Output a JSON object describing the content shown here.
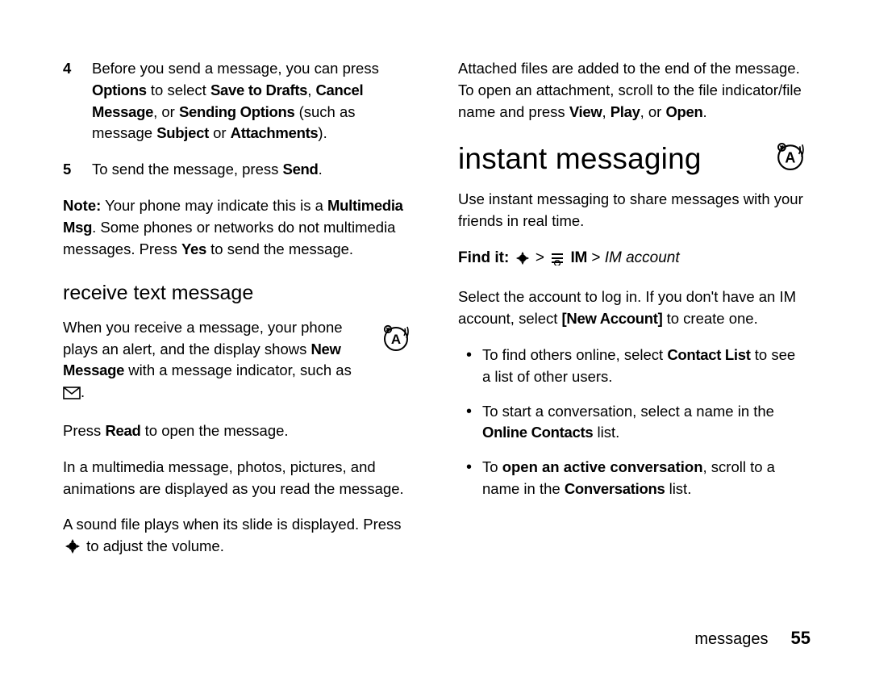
{
  "chart_data": null,
  "left": {
    "step4": {
      "num": "4",
      "t1": "Before you send a message, you can press ",
      "k1": "Options",
      "t2": " to select ",
      "k2": "Save to Drafts",
      "t3": ", ",
      "k3": "Cancel Message",
      "t4": ", or ",
      "k4": "Sending Options",
      "t5": " (such as message ",
      "k5": "Subject",
      "t6": " or ",
      "k6": "Attachments",
      "t7": ")."
    },
    "step5": {
      "num": "5",
      "t1": "To send the message, press ",
      "k1": "Send",
      "t2": "."
    },
    "note": {
      "label": "Note:",
      "t1": " Your phone may indicate this is a ",
      "k1": "Multimedia Msg",
      "t2": ". Some phones or networks do not multimedia messages. Press ",
      "k2": "Yes",
      "t3": " to send the message."
    },
    "h2": "receive text message",
    "rcv": {
      "t1": "When you receive a message, your phone plays an alert, and the display shows ",
      "k1": "New Message",
      "t2": " with a message indicator, such as ",
      "t3": "."
    },
    "read": {
      "t1": "Press ",
      "k1": "Read",
      "t2": " to open the message."
    },
    "mm": "In a multimedia message, photos, pictures, and animations are displayed as you read the message.",
    "sound": {
      "t1": "A sound file plays when its slide is displayed. Press ",
      "t2": " to adjust the volume."
    }
  },
  "right": {
    "attach": {
      "t1": "Attached files are added to the end of the message. To open an attachment, scroll to the file indicator/file name and press ",
      "k1": "View",
      "t2": ", ",
      "k2": "Play",
      "t3": ", or ",
      "k3": "Open",
      "t4": "."
    },
    "h1": "instant messaging",
    "im_intro": "Use instant messaging to share messages with your friends in real time.",
    "findit": {
      "label": "Find it:",
      "sep1": " > ",
      "k1": "IM",
      "sep2": " > ",
      "ital": "IM account"
    },
    "login": {
      "t1": "Select the account to log in. If you don't have an IM account, select ",
      "k1": "[New Account]",
      "t2": " to create one."
    },
    "b1": {
      "t1": "To find others online, select ",
      "k1": "Contact List",
      "t2": " to see a list of other users."
    },
    "b2": {
      "t1": "To start a conversation, select a name in the ",
      "k1": "Online Contacts",
      "t2": " list."
    },
    "b3": {
      "t1": "To ",
      "b1": "open an active conversation",
      "t2": ", scroll to a name in the ",
      "k1": "Conversations",
      "t3": " list."
    }
  },
  "footer": {
    "section": "messages",
    "page": "55"
  }
}
